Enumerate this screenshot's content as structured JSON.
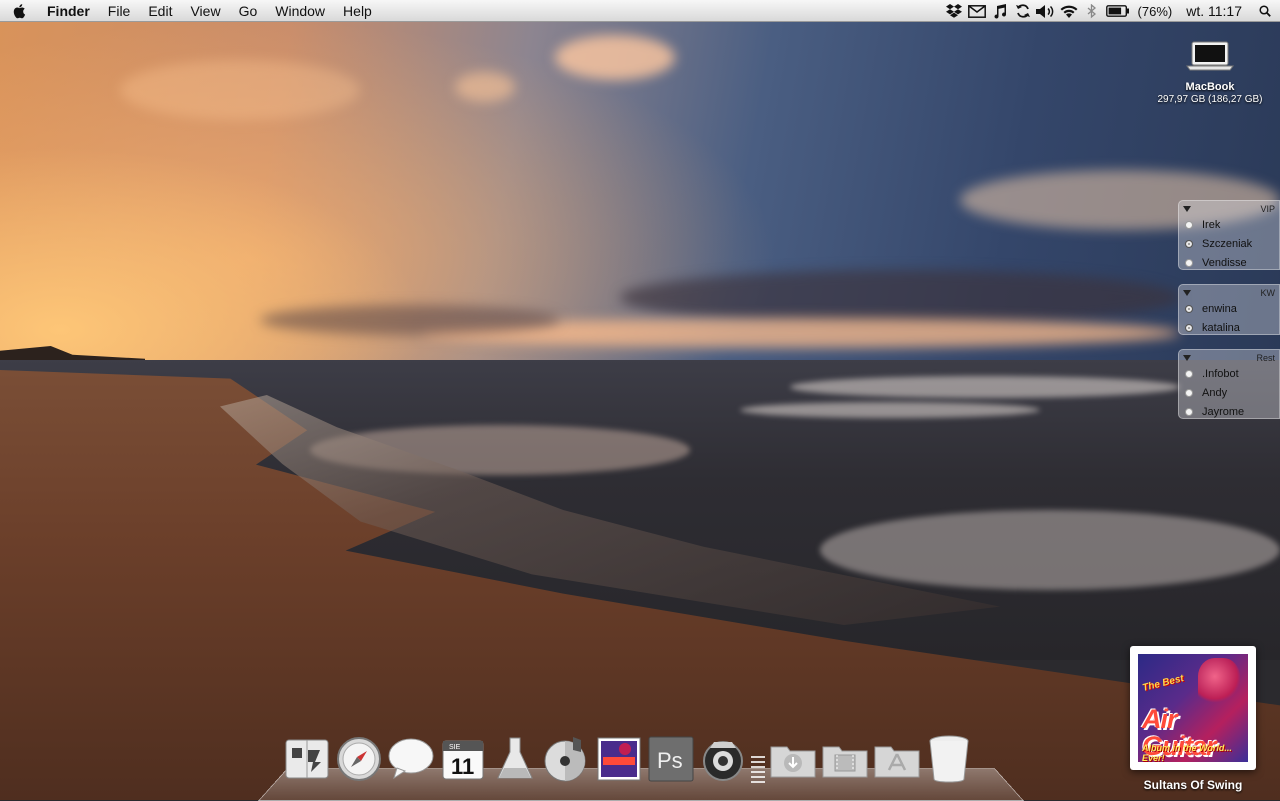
{
  "menubar": {
    "apple_icon": "apple-logo-icon",
    "app_name": "Finder",
    "menus": [
      "File",
      "Edit",
      "View",
      "Go",
      "Window",
      "Help"
    ],
    "status_icons": [
      "dropbox-icon",
      "mail-icon",
      "music-note-icon",
      "sync-icon",
      "volume-icon",
      "wifi-icon",
      "bluetooth-icon",
      "battery-icon"
    ],
    "battery_percent": "(76%)",
    "clock": "wt. 11:17",
    "spotlight_icon": "spotlight-icon"
  },
  "desktop": {
    "drive": {
      "name": "MacBook",
      "size": "297,97 GB (186,27 GB)",
      "icon": "laptop-icon"
    }
  },
  "buddy_groups": [
    {
      "title": "VIP",
      "buddies": [
        {
          "name": "Irek",
          "status": "available"
        },
        {
          "name": "Szczeniak",
          "status": "away"
        },
        {
          "name": "Vendisse",
          "status": "available"
        }
      ]
    },
    {
      "title": "KW",
      "buddies": [
        {
          "name": "enwina",
          "status": "away"
        },
        {
          "name": "katalina",
          "status": "away"
        }
      ]
    },
    {
      "title": "Rest",
      "buddies": [
        {
          "name": ".Infobot",
          "status": "available"
        },
        {
          "name": "Andy",
          "status": "available"
        },
        {
          "name": "Jayrome",
          "status": "available"
        }
      ]
    }
  ],
  "now_playing": {
    "album_cover_text": {
      "line1": "The Best",
      "line2": "Air Guitar",
      "line3": "Album in the World... Ever!"
    },
    "track": "Sultans Of Swing"
  },
  "dock": {
    "calendar_month": "SIE",
    "calendar_day": "11",
    "photoshop_label": "Ps",
    "items": [
      "finder-icon",
      "safari-icon",
      "messages-icon",
      "ical-icon",
      "lab-flask-icon",
      "itunes-icon",
      "album-art-icon",
      "photoshop-icon",
      "camera-icon",
      "downloads-stack-icon",
      "movies-folder-icon",
      "applications-folder-icon",
      "trash-icon"
    ]
  },
  "colors": {
    "menubar_bg": "#e6e6e6",
    "available": "#f4f4f4",
    "away": "#8a8a8a"
  }
}
